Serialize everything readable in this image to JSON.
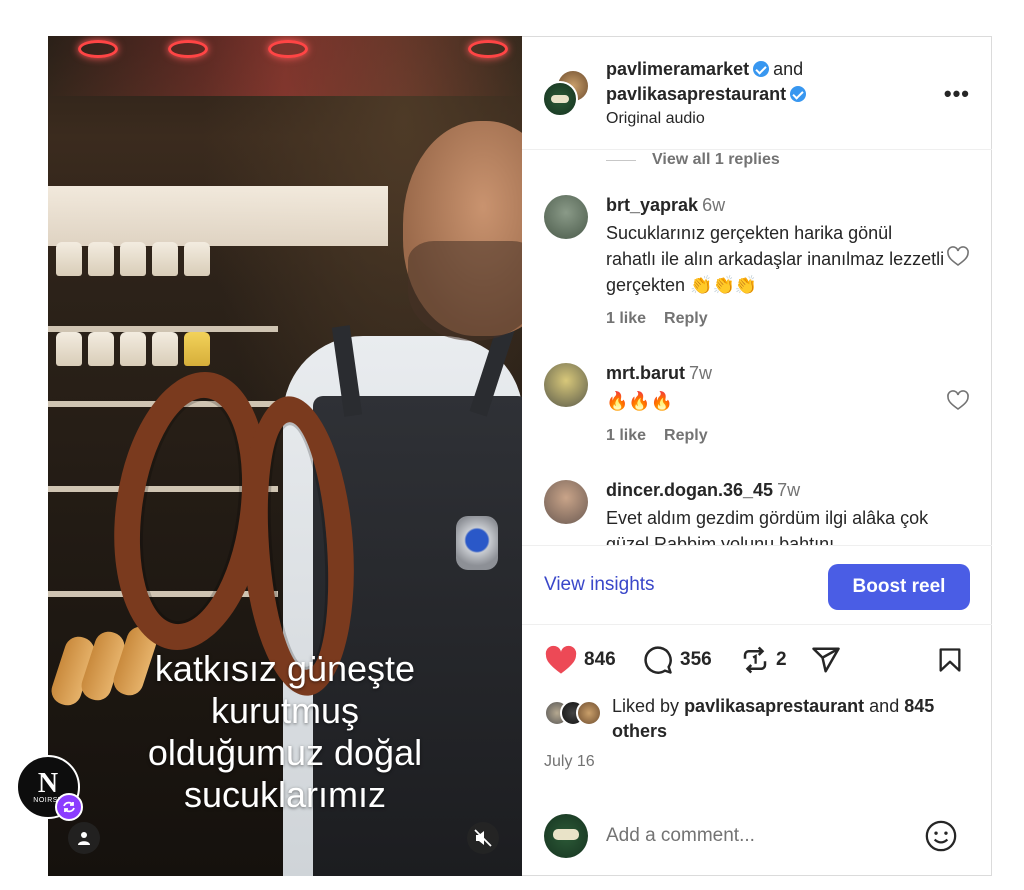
{
  "video": {
    "caption_lines": [
      "katkısız güneşte",
      "kurutmuş",
      "olduğumuz doğal",
      "sucuklarımız"
    ],
    "overlay_badge_letter": "N",
    "overlay_badge_text": "NOIRST"
  },
  "header": {
    "account1": "pavlimeramarket",
    "and_text": "and",
    "account2": "pavlikasaprestaurant",
    "audio": "Original audio"
  },
  "comments": {
    "view_replies": "View all 1 replies",
    "items": [
      {
        "user": "brt_yaprak",
        "time": "6w",
        "text": "Sucuklarınız gerçekten harika gönül rahatlı ile alın arkadaşlar inanılmaz lezzetli gerçekten 👏👏👏",
        "likes": "1 like",
        "reply": "Reply"
      },
      {
        "user": "mrt.barut",
        "time": "7w",
        "text": "🔥🔥🔥",
        "likes": "1 like",
        "reply": "Reply"
      },
      {
        "user": "dincer.dogan.36_45",
        "time": "7w",
        "text": "Evet aldım gezdim gördüm ilgi alâka çok güzel Rabbim yolunu bahtını"
      }
    ]
  },
  "insights": {
    "view_label": "View insights",
    "boost_label": "Boost reel"
  },
  "actions": {
    "likes": "846",
    "comments": "356",
    "reposts": "2"
  },
  "liked_by": {
    "prefix": "Liked by",
    "user": "pavlikasaprestaurant",
    "and_text": "and",
    "others": "845 others"
  },
  "date": "July 16",
  "add_comment": {
    "placeholder": "Add a comment..."
  },
  "colors": {
    "heart": "#ed4956",
    "link_blue": "#3a47c9",
    "boost": "#4a5de5",
    "verified": "#3897f0"
  }
}
